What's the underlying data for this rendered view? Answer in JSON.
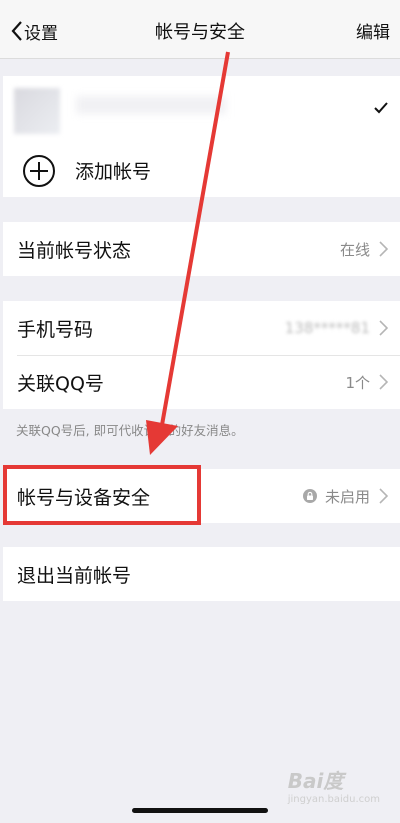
{
  "nav": {
    "back_label": "设置",
    "title": "帐号与安全",
    "edit_label": "编辑"
  },
  "accounts": {
    "add_label": "添加帐号"
  },
  "status_row": {
    "label": "当前帐号状态",
    "value": "在线"
  },
  "phone_row": {
    "label": "手机号码",
    "value": "138*****81"
  },
  "qq_row": {
    "label": "关联QQ号",
    "value": "1个"
  },
  "qq_hint": "关联QQ号后, 即可代收该号的好友消息。",
  "device_row": {
    "label": "帐号与设备安全",
    "value": "未启用"
  },
  "logout_row": {
    "label": "退出当前帐号"
  },
  "watermark": {
    "brand": "Bai度",
    "sub": "jingyan.baidu.com"
  },
  "colors": {
    "background": "#efeff4",
    "annotation_red": "#e53935",
    "secondary_text": "#8a8a8a"
  }
}
